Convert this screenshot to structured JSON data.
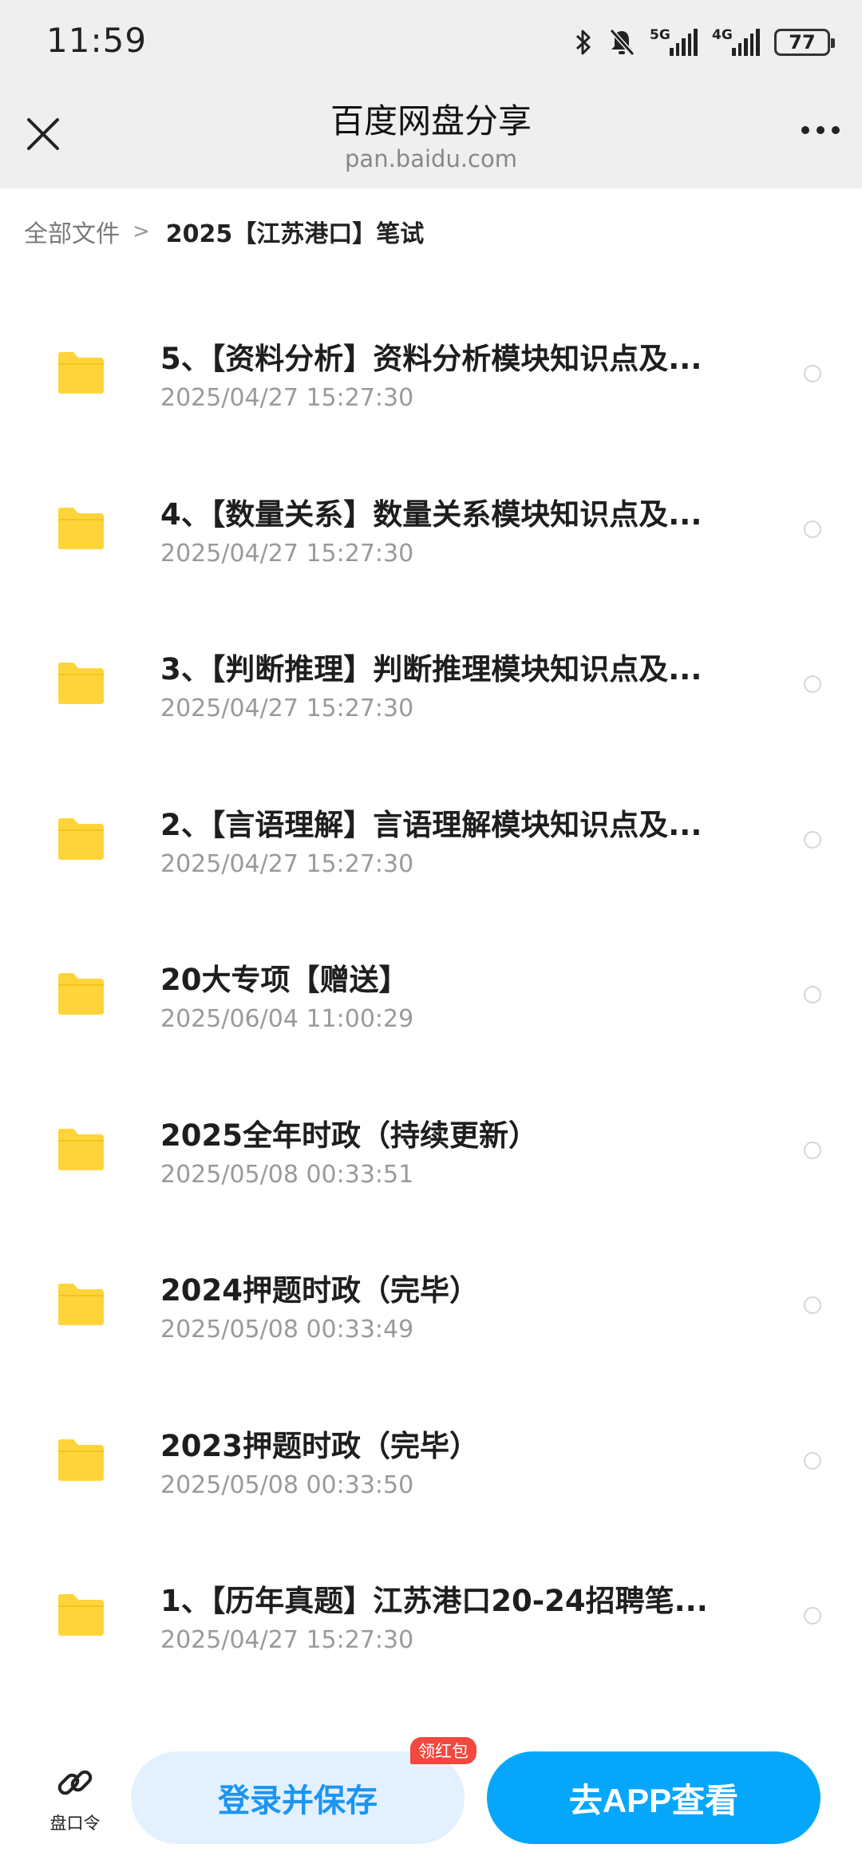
{
  "status_bar": {
    "time": "11:59",
    "icons": [
      "bluetooth-icon",
      "bell-off-icon",
      "signal-5g-icon",
      "signal-4g-icon"
    ],
    "sig1_label": "5G",
    "sig2_label": "4G",
    "battery": "77"
  },
  "header": {
    "title": "百度网盘分享",
    "subtitle": "pan.baidu.com"
  },
  "breadcrumb": {
    "root": "全部文件",
    "separator": ">",
    "current": "2025【江苏港口】笔试"
  },
  "files": [
    {
      "name": "5、【资料分析】资料分析模块知识点及...",
      "date": "2025/04/27 15:27:30"
    },
    {
      "name": "4、【数量关系】数量关系模块知识点及...",
      "date": "2025/04/27 15:27:30"
    },
    {
      "name": "3、【判断推理】判断推理模块知识点及...",
      "date": "2025/04/27 15:27:30"
    },
    {
      "name": "2、【言语理解】言语理解模块知识点及...",
      "date": "2025/04/27 15:27:30"
    },
    {
      "name": "20大专项【赠送】",
      "date": "2025/06/04 11:00:29"
    },
    {
      "name": "2025全年时政（持续更新）",
      "date": "2025/05/08 00:33:51"
    },
    {
      "name": "2024押题时政（完毕）",
      "date": "2025/05/08 00:33:49"
    },
    {
      "name": "2023押题时政（完毕）",
      "date": "2025/05/08 00:33:50"
    },
    {
      "name": "1、【历年真题】江苏港口20-24招聘笔...",
      "date": "2025/04/27 15:27:30"
    }
  ],
  "bottom_bar": {
    "pankouling_label": "盘口令",
    "login_save_label": "登录并保存",
    "badge": "领红包",
    "open_app_label": "去APP查看"
  },
  "colors": {
    "accent": "#06a7fa",
    "folder": "#ffd43b",
    "badge": "#f2483e"
  }
}
